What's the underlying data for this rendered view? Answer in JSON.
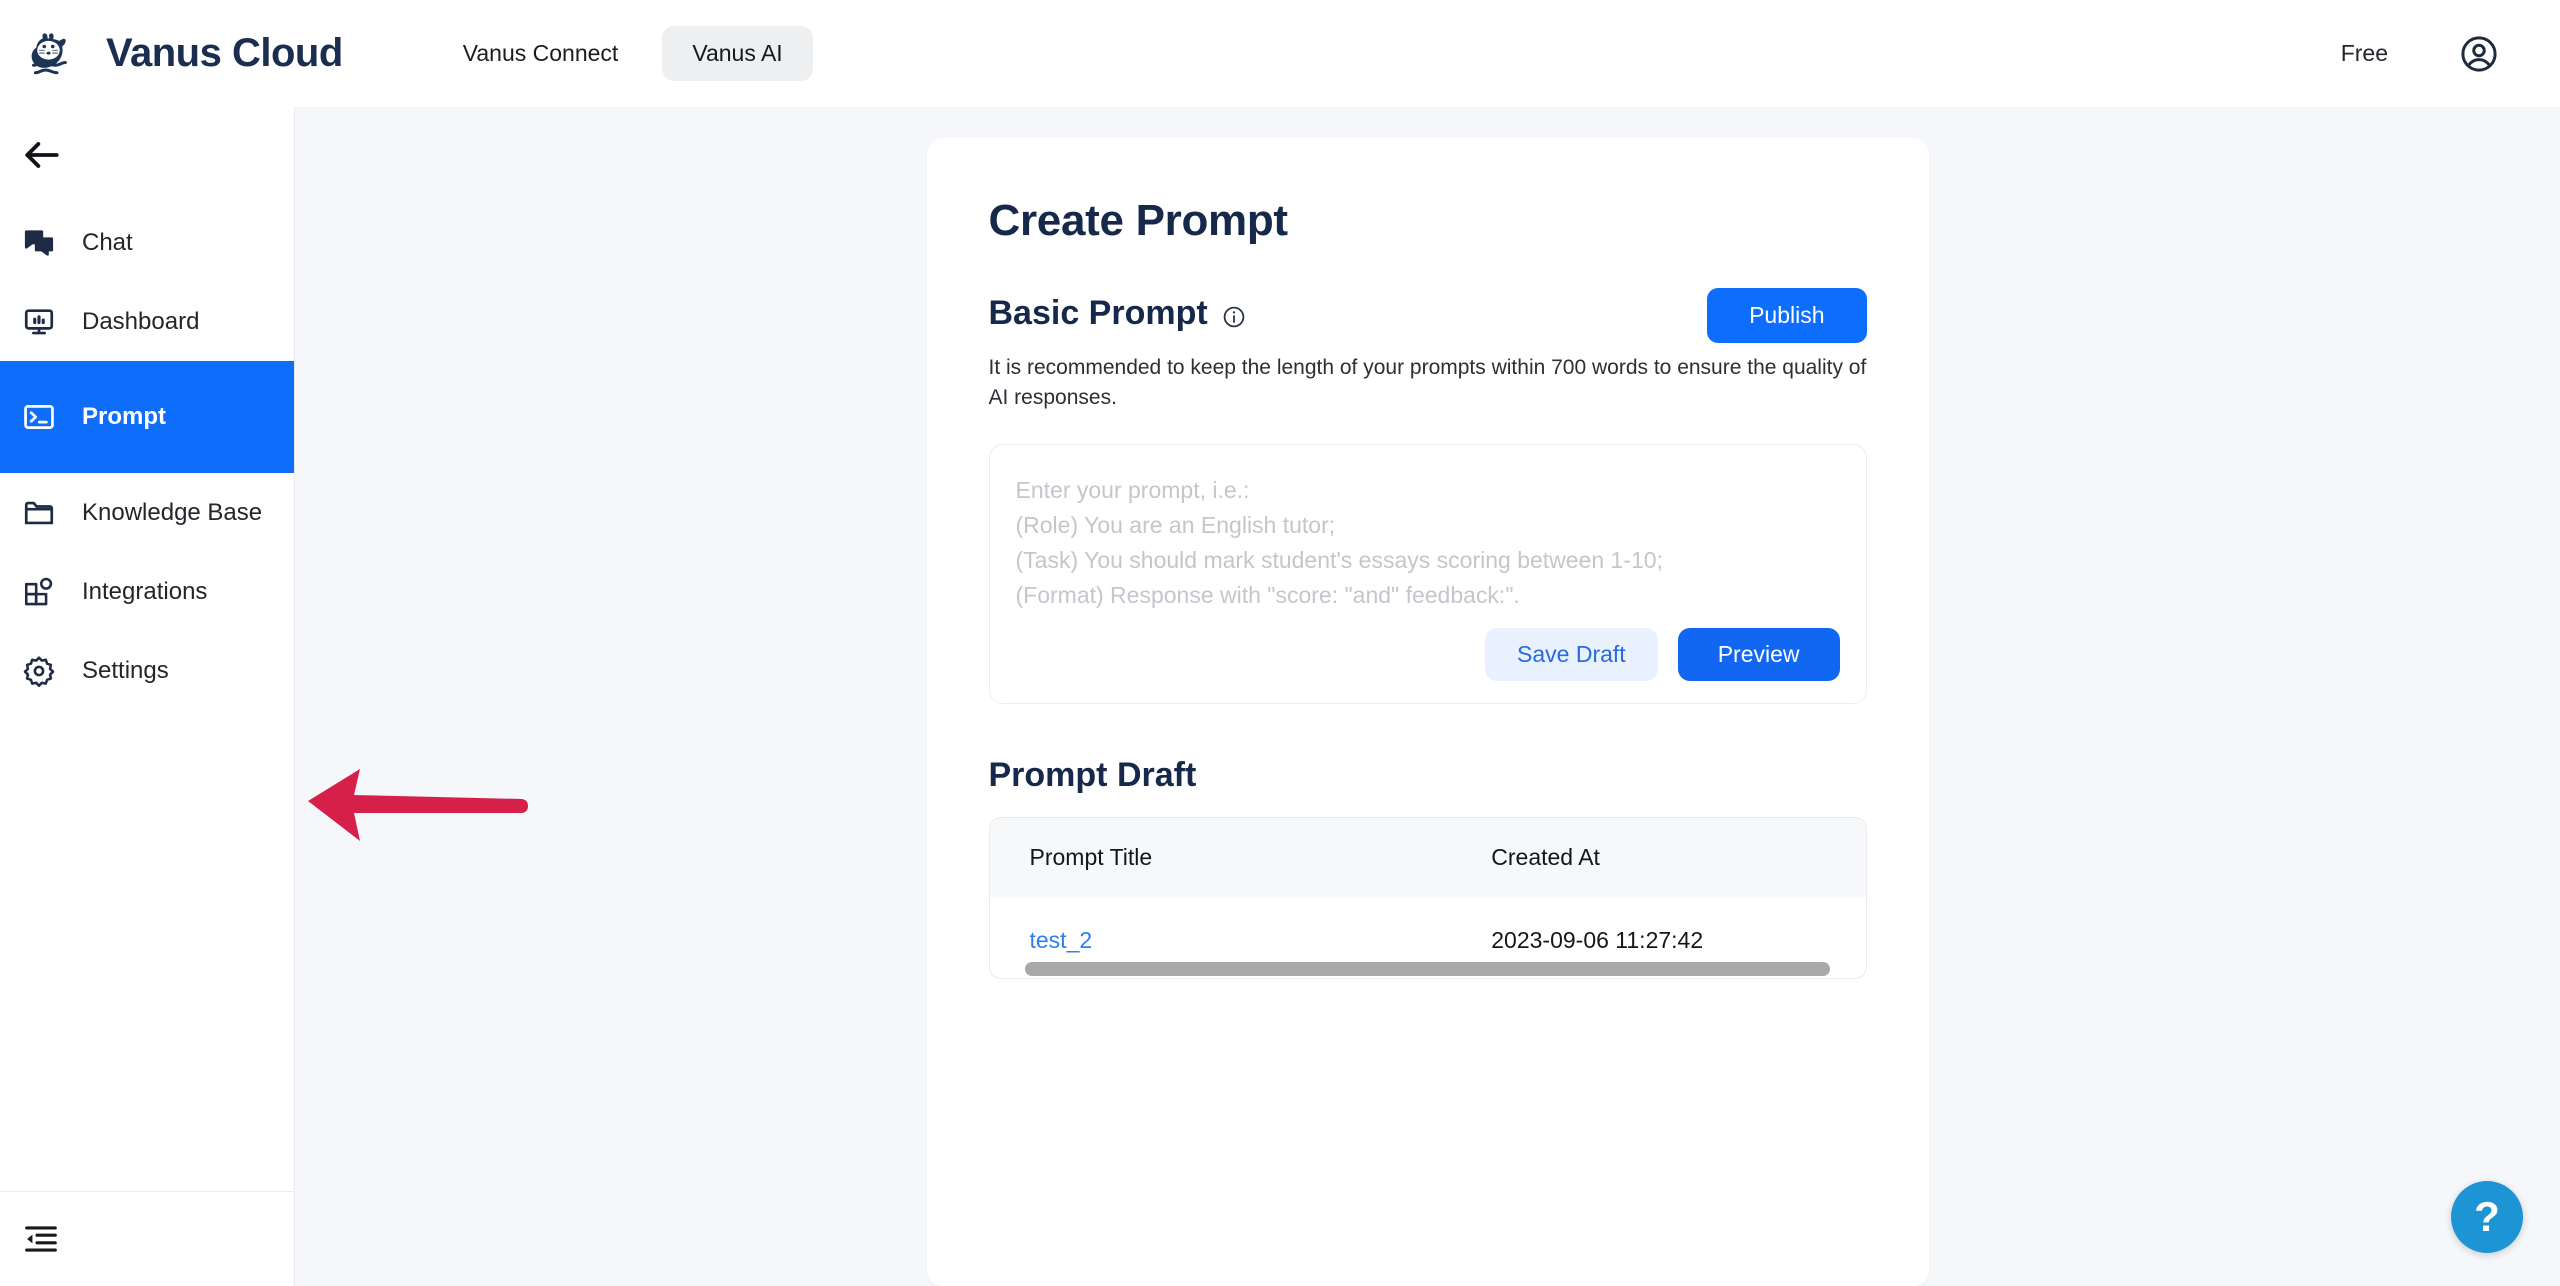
{
  "header": {
    "brand_name": "Vanus Cloud",
    "logo_icon": "seal-mascot-logo",
    "nav": [
      {
        "label": "Vanus Connect",
        "active": false
      },
      {
        "label": "Vanus AI",
        "active": true
      }
    ],
    "plan_label": "Free",
    "account_icon": "user-circle-icon"
  },
  "sidebar": {
    "back_icon": "arrow-left-icon",
    "collapse_icon": "collapse-sidebar-icon",
    "items": [
      {
        "label": "Chat",
        "icon": "chat-bubbles-icon",
        "active": false
      },
      {
        "label": "Dashboard",
        "icon": "monitor-chart-icon",
        "active": false
      },
      {
        "label": "Prompt",
        "icon": "terminal-icon",
        "active": true
      },
      {
        "label": "Knowledge Base",
        "icon": "folder-icon",
        "active": false
      },
      {
        "label": "Integrations",
        "icon": "blocks-icon",
        "active": false
      },
      {
        "label": "Settings",
        "icon": "gear-icon",
        "active": false
      }
    ]
  },
  "main": {
    "page_title": "Create Prompt",
    "basic_prompt": {
      "section_title": "Basic Prompt",
      "info_icon": "info-circle-icon",
      "publish_label": "Publish",
      "helper_text": "It is recommended to keep the length of your prompts within 700 words to ensure the quality of AI responses.",
      "textarea_value": "",
      "textarea_placeholder": "Enter your prompt, i.e.:\n(Role) You are an English tutor;\n(Task) You should mark student's essays scoring between 1-10;\n(Format) Response with \"score: \"and\" feedback:\".",
      "save_draft_label": "Save Draft",
      "preview_label": "Preview"
    },
    "prompt_draft": {
      "section_title": "Prompt Draft",
      "columns": [
        "Prompt Title",
        "Created At"
      ],
      "rows": [
        {
          "title": "test_2",
          "created_at": "2023-09-06 11:27:42"
        }
      ]
    }
  },
  "overlays": {
    "help_label": "?",
    "annotation_arrow": "red-left-arrow-annotation"
  },
  "colors": {
    "accent_blue": "#0d6efd",
    "sidebar_active": "#0f6dfb",
    "brand_navy": "#16294a",
    "annotation_red": "#d6204a",
    "help_cyan": "#1d95d4",
    "link_blue": "#2d7ff0"
  }
}
